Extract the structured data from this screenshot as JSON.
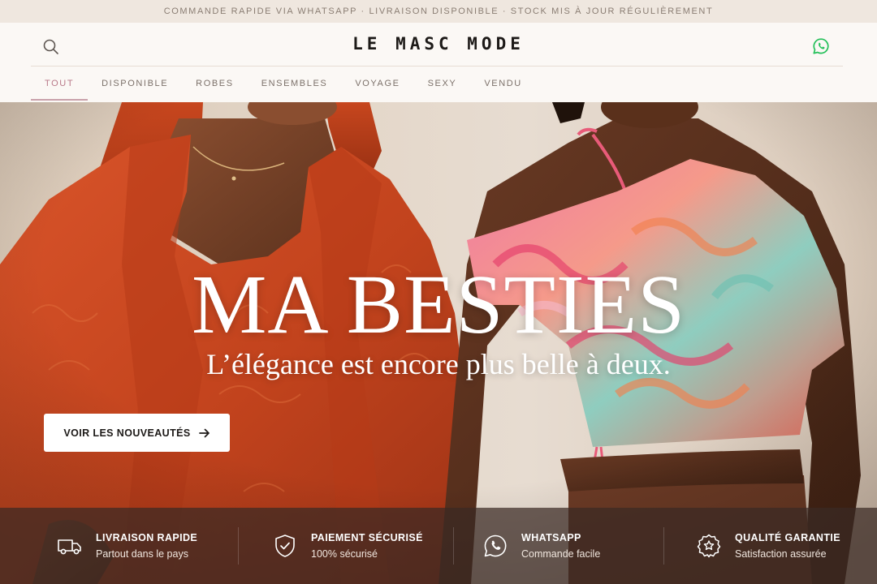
{
  "announcement": "COMMANDE RAPIDE VIA WHATSAPP · LIVRAISON DISPONIBLE · STOCK MIS À JOUR RÉGULIÈREMENT",
  "header": {
    "brand": "LE MASC MODE",
    "search_icon": "search-icon",
    "whatsapp_icon": "whatsapp-icon",
    "accent_color": "#b97989",
    "whatsapp_color": "#25c05a"
  },
  "nav": {
    "items": [
      {
        "label": "TOUT",
        "active": true
      },
      {
        "label": "DISPONIBLE",
        "active": false
      },
      {
        "label": "ROBES",
        "active": false
      },
      {
        "label": "ENSEMBLES",
        "active": false
      },
      {
        "label": "VOYAGE",
        "active": false
      },
      {
        "label": "SEXY",
        "active": false
      },
      {
        "label": "VENDU",
        "active": false
      }
    ]
  },
  "hero": {
    "title": "MA BESTIES",
    "subtitle": "L’élégance est encore plus belle à deux.",
    "cta_label": "VOIR LES NOUVEAUTÉS",
    "cta_icon": "arrow-right-icon",
    "image": "hero-photo"
  },
  "features": [
    {
      "icon": "truck-icon",
      "title": "LIVRAISON RAPIDE",
      "subtitle": "Partout dans le pays"
    },
    {
      "icon": "shield-check-icon",
      "title": "PAIEMENT SÉCURISÉ",
      "subtitle": "100% sécurisé"
    },
    {
      "icon": "whatsapp-icon",
      "title": "WHATSAPP",
      "subtitle": "Commande facile"
    },
    {
      "icon": "star-badge-icon",
      "title": "QUALITÉ GARANTIE",
      "subtitle": "Satisfaction assurée"
    }
  ]
}
